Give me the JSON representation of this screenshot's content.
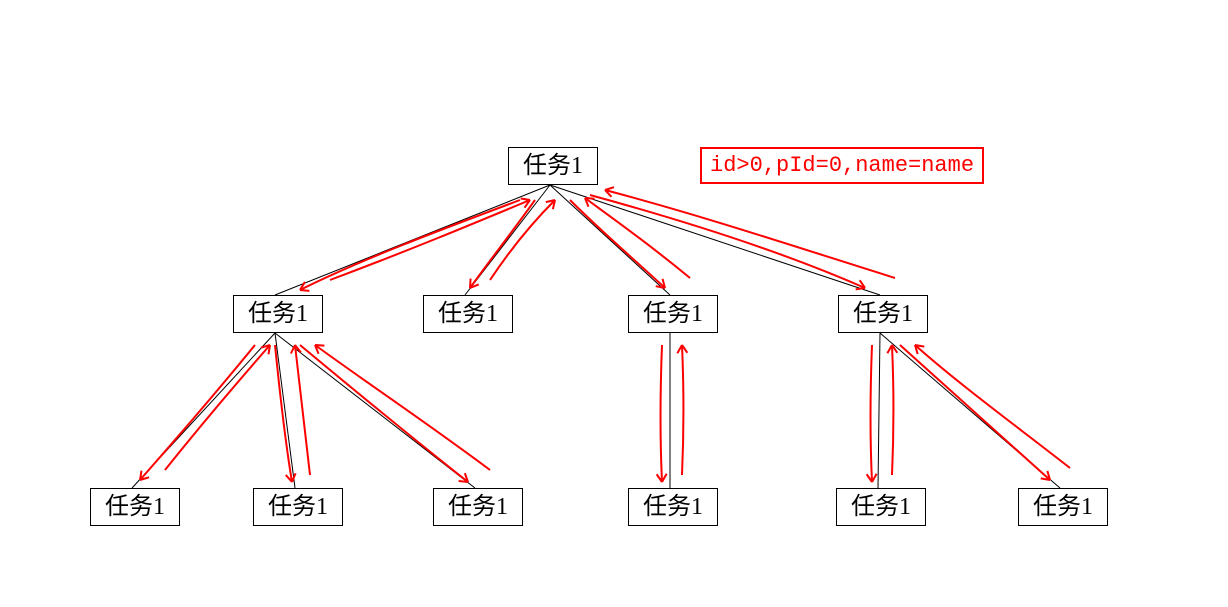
{
  "annotation": {
    "text": "id>0,pId=0,name=name"
  },
  "nodes": {
    "root": {
      "label": "任务1"
    },
    "l2a": {
      "label": "任务1"
    },
    "l2b": {
      "label": "任务1"
    },
    "l2c": {
      "label": "任务1"
    },
    "l2d": {
      "label": "任务1"
    },
    "l3a": {
      "label": "任务1"
    },
    "l3b": {
      "label": "任务1"
    },
    "l3c": {
      "label": "任务1"
    },
    "l3d": {
      "label": "任务1"
    },
    "l3e": {
      "label": "任务1"
    },
    "l3f": {
      "label": "任务1"
    }
  },
  "colors": {
    "box_border": "#000000",
    "annotation_color": "#ff0000",
    "tree_line": "#000000",
    "arrow_color": "#ff0000"
  }
}
